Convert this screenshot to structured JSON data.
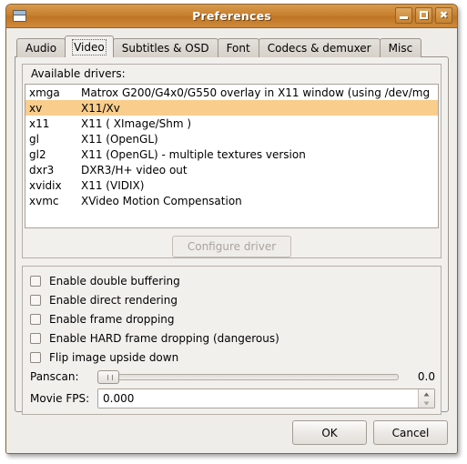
{
  "window": {
    "title": "Preferences",
    "icon": "window-icon",
    "controls": {
      "minimize": "Minimize",
      "maximize": "Maximize",
      "close": "✖"
    }
  },
  "tabs": [
    {
      "label": "Audio",
      "active": false
    },
    {
      "label": "Video",
      "active": true
    },
    {
      "label": "Subtitles & OSD",
      "active": false
    },
    {
      "label": "Font",
      "active": false
    },
    {
      "label": "Codecs & demuxer",
      "active": false
    },
    {
      "label": "Misc",
      "active": false
    }
  ],
  "drivers": {
    "label": "Available drivers:",
    "selected": "xv",
    "rows": [
      {
        "name": "xmga",
        "description": "Matrox G200/G4x0/G550 overlay in X11 window (using /dev/mg"
      },
      {
        "name": "xv",
        "description": "X11/Xv"
      },
      {
        "name": "x11",
        "description": "X11 ( XImage/Shm )"
      },
      {
        "name": "gl",
        "description": "X11 (OpenGL)"
      },
      {
        "name": "gl2",
        "description": "X11 (OpenGL) - multiple textures version"
      },
      {
        "name": "dxr3",
        "description": "DXR3/H+ video out"
      },
      {
        "name": "xvidix",
        "description": "X11 (VIDIX)"
      },
      {
        "name": "xvmc",
        "description": "XVideo Motion Compensation"
      }
    ],
    "configure_button": "Configure driver"
  },
  "options": {
    "checkboxes": [
      {
        "label": "Enable double buffering",
        "checked": false
      },
      {
        "label": "Enable direct rendering",
        "checked": false
      },
      {
        "label": "Enable frame dropping",
        "checked": false
      },
      {
        "label": "Enable HARD frame dropping (dangerous)",
        "checked": false
      },
      {
        "label": "Flip image upside down",
        "checked": false
      }
    ],
    "panscan": {
      "label": "Panscan:",
      "value": "0.0",
      "min": 0,
      "max": 1
    },
    "movie_fps": {
      "label": "Movie FPS:",
      "value": "0.000"
    }
  },
  "actions": {
    "ok": "OK",
    "cancel": "Cancel"
  },
  "colors": {
    "titlebar": "#c8802f",
    "selection": "#f9cd8c",
    "dialog_bg": "#efedea",
    "page_bg": "#f2f0ed"
  }
}
